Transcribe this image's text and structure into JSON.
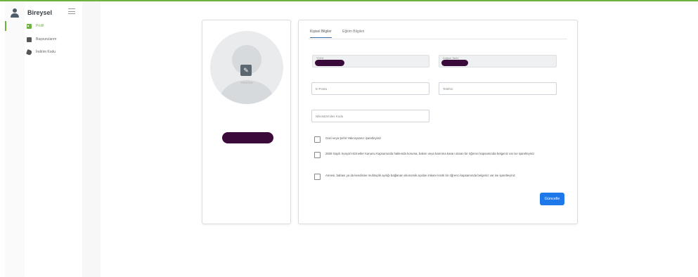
{
  "sidebar": {
    "brand": "Bireysel",
    "items": [
      {
        "label": "Profil",
        "icon": "profile-card-icon",
        "active": true
      },
      {
        "label": "Başvurularım",
        "icon": "document-icon",
        "active": false
      },
      {
        "label": "İndirim Kodu",
        "icon": "tag-icon",
        "active": false
      }
    ]
  },
  "profile": {
    "avatar_label": "PROFİLE"
  },
  "tabs": [
    {
      "label": "Kişisel Bilgiler",
      "active": true
    },
    {
      "label": "Eğitim Bilgileri",
      "active": false
    }
  ],
  "form": {
    "tc_label": "TCKN",
    "birth_label": "Doğum Tarihi",
    "email_placeholder": "E-Posta",
    "phone_placeholder": "Telefon",
    "ref_placeholder": "Nilies&Smiles Kodu",
    "checkbox_1": "Gazi veya Şehit Yakınıysanız işaretleyiniz",
    "checkbox_2": "2828 Sayılı Sosyal Hizmetler Kanunu Kapsamında hakkında koruma, bakım veya barınma kararı alınan bir öğrenci kapsamında belgeniz var ise işaretleyiniz",
    "checkbox_3": "Annesi, babası ya da kendisine muhtaçlık ayılığı bağlanan ekonomik açıdan imkanı kısıtlı bir öğrenci kapsamında belgeniz var ise işaretleyiniz",
    "submit_label": "Güncelle"
  },
  "colors": {
    "accent_green": "#6cb33e",
    "primary_blue": "#1f78ea",
    "redaction": "#3a0a3a"
  }
}
